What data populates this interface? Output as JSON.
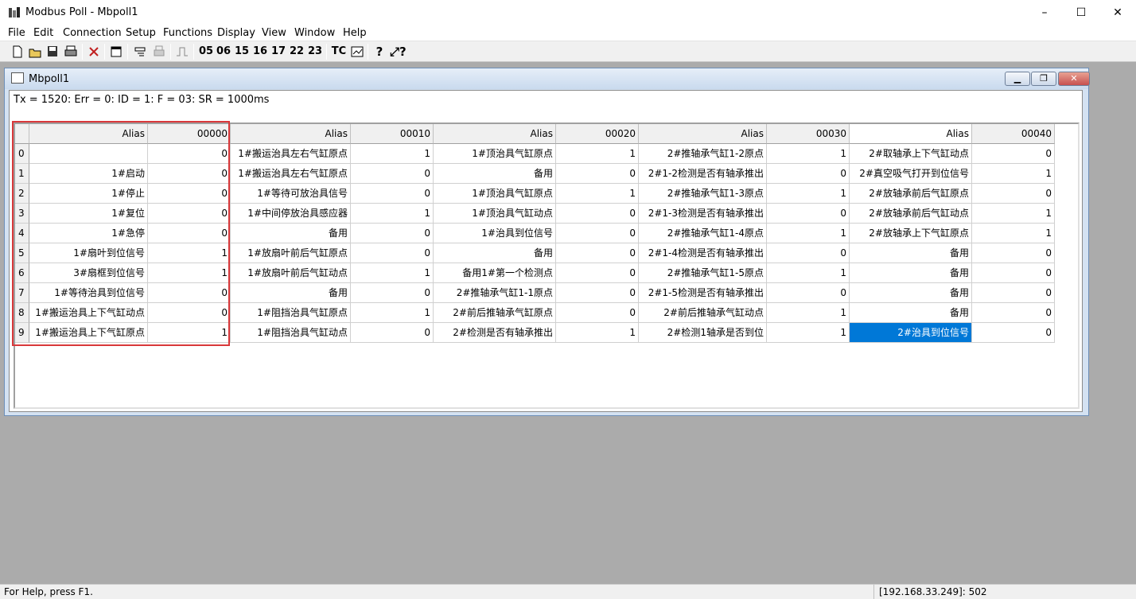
{
  "window": {
    "title": "Modbus Poll - Mbpoll1",
    "minimize": "–",
    "maximize": "☐",
    "close": "✕"
  },
  "menu": [
    "File",
    "Edit",
    "Connection",
    "Setup",
    "Functions",
    "Display",
    "View",
    "Window",
    "Help"
  ],
  "toolbar": {
    "function_codes": [
      "05",
      "06",
      "15",
      "16",
      "17",
      "22",
      "23"
    ],
    "tc": "TC"
  },
  "child": {
    "title": "Mbpoll1",
    "status": "Tx = 1520: Err = 0: ID = 1: F = 03: SR = 1000ms"
  },
  "grid": {
    "headers": [
      "Alias",
      "00000",
      "Alias",
      "00010",
      "Alias",
      "00020",
      "Alias",
      "00030",
      "Alias",
      "00040"
    ],
    "row_labels": [
      "0",
      "1",
      "2",
      "3",
      "4",
      "5",
      "6",
      "7",
      "8",
      "9"
    ],
    "rows": [
      [
        "",
        "0",
        "1#搬运治具左右气缸原点",
        "1",
        "1#顶治具气缸原点",
        "1",
        "2#推轴承气缸1-2原点",
        "1",
        "2#取轴承上下气缸动点",
        "0"
      ],
      [
        "1#启动",
        "0",
        "1#搬运治具左右气缸原点",
        "0",
        "备用",
        "0",
        "2#1-2检测是否有轴承推出",
        "0",
        "2#真空吸气打开到位信号",
        "1"
      ],
      [
        "1#停止",
        "0",
        "1#等待可放治具信号",
        "0",
        "1#顶治具气缸原点",
        "1",
        "2#推轴承气缸1-3原点",
        "1",
        "2#放轴承前后气缸原点",
        "0"
      ],
      [
        "1#复位",
        "0",
        "1#中间停放治具感应器",
        "1",
        "1#顶治具气缸动点",
        "0",
        "2#1-3检测是否有轴承推出",
        "0",
        "2#放轴承前后气缸动点",
        "1"
      ],
      [
        "1#急停",
        "0",
        "备用",
        "0",
        "1#治具到位信号",
        "0",
        "2#推轴承气缸1-4原点",
        "1",
        "2#放轴承上下气缸原点",
        "1"
      ],
      [
        "1#扇叶到位信号",
        "1",
        "1#放扇叶前后气缸原点",
        "0",
        "备用",
        "0",
        "2#1-4检测是否有轴承推出",
        "0",
        "备用",
        "0"
      ],
      [
        "3#扇框到位信号",
        "1",
        "1#放扇叶前后气缸动点",
        "1",
        "备用1#第一个检测点",
        "0",
        "2#推轴承气缸1-5原点",
        "1",
        "备用",
        "0"
      ],
      [
        "1#等待治具到位信号",
        "0",
        "备用",
        "0",
        "2#推轴承气缸1-1原点",
        "0",
        "2#1-5检测是否有轴承推出",
        "0",
        "备用",
        "0"
      ],
      [
        "1#搬运治具上下气缸动点",
        "0",
        "1#阻挡治具气缸原点",
        "1",
        "2#前后推轴承气缸原点",
        "0",
        "2#前后推轴承气缸动点",
        "1",
        "备用",
        "0"
      ],
      [
        "1#搬运治具上下气缸原点",
        "1",
        "1#阻挡治具气缸动点",
        "0",
        "2#检测是否有轴承推出",
        "1",
        "2#检测1轴承是否到位",
        "1",
        "2#治具到位信号",
        "0"
      ]
    ],
    "selected_cell": {
      "row": 9,
      "col": 8
    }
  },
  "statusbar": {
    "help": "For Help, press F1.",
    "connection": "[192.168.33.249]: 502"
  },
  "colors": {
    "selection": "#0078d7",
    "highlight_box": "#d9383a",
    "mdi_background": "#ababab"
  }
}
